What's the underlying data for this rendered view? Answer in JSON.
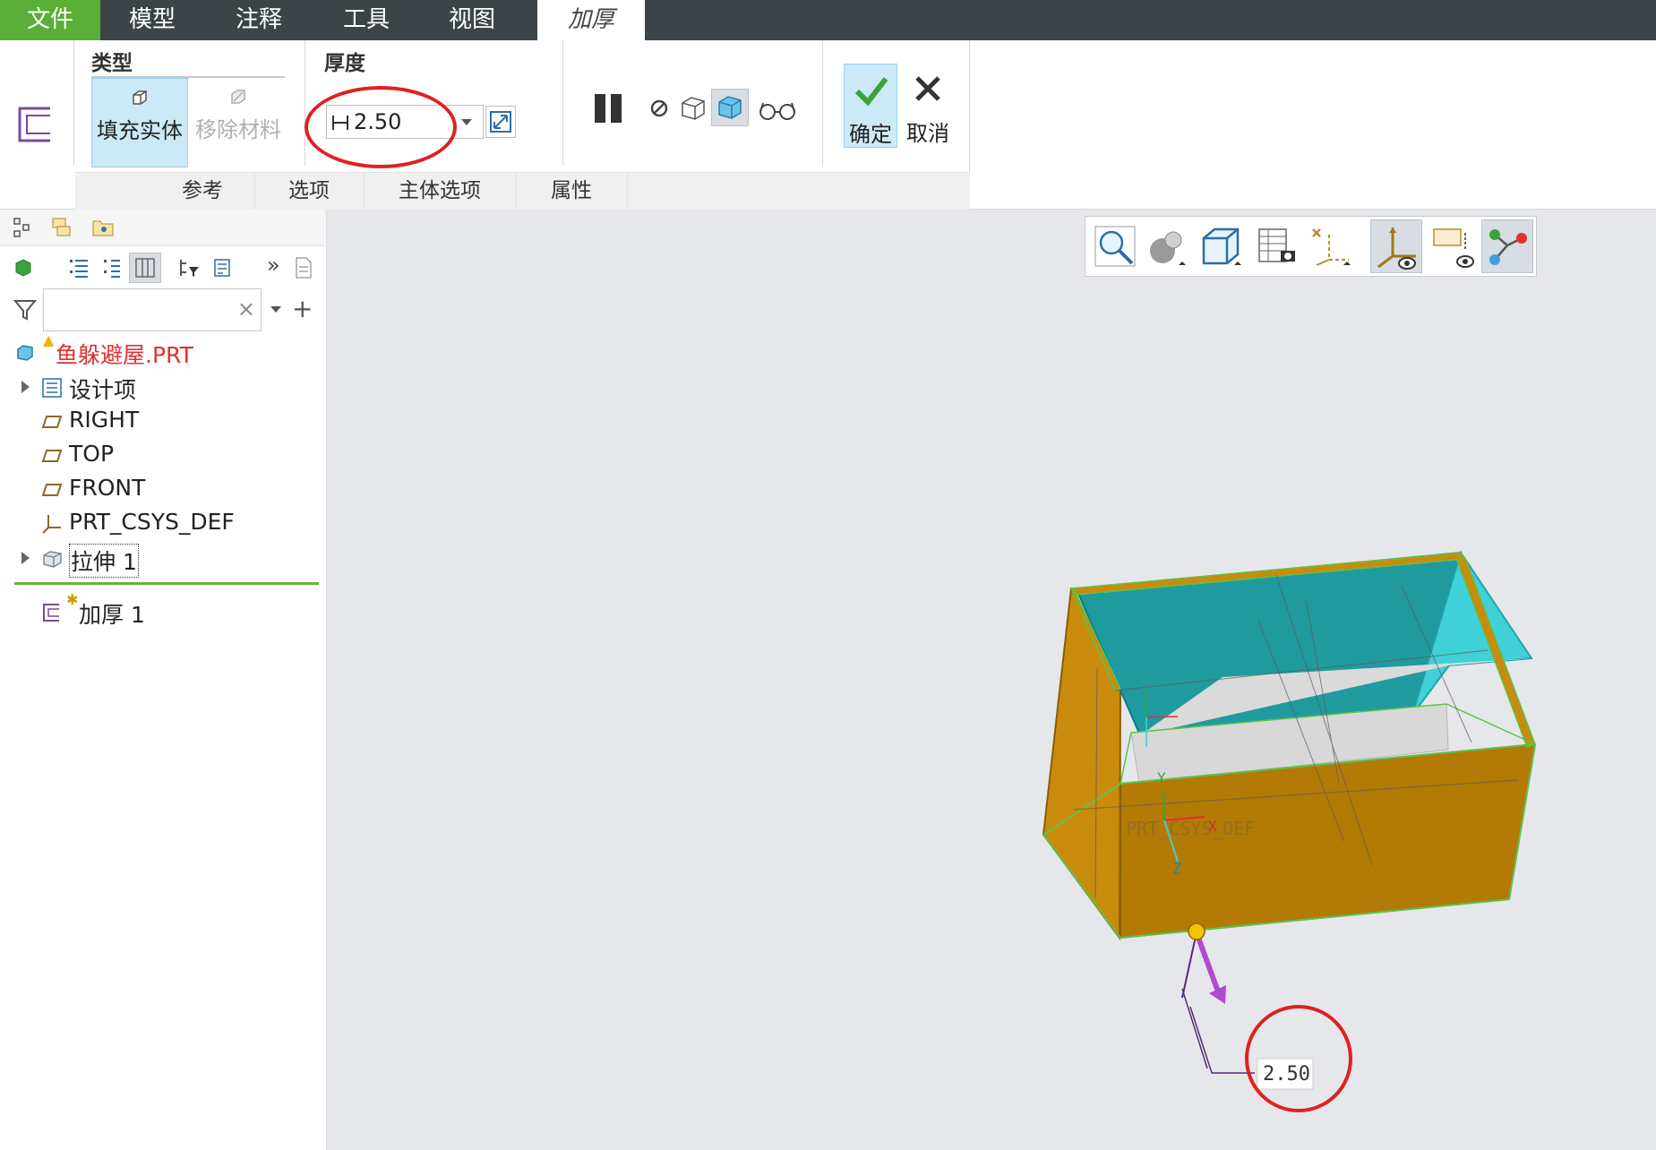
{
  "menu": {
    "tabs": [
      "文件",
      "模型",
      "注释",
      "工具",
      "视图"
    ],
    "active_tab": "加厚"
  },
  "ribbon": {
    "type_group": {
      "title": "类型",
      "fill_solid": "填充实体",
      "remove_material": "移除材料"
    },
    "thickness_group": {
      "title": "厚度",
      "value": "2.50"
    },
    "actions": {
      "ok": "确定",
      "cancel": "取消"
    },
    "subtabs": [
      "参考",
      "选项",
      "主体选项",
      "属性"
    ]
  },
  "model_tree": {
    "search_placeholder": "",
    "items": [
      {
        "label": "鱼躲避屋.PRT",
        "icon": "part-icon"
      },
      {
        "label": "设计项",
        "icon": "design-items-icon"
      },
      {
        "label": "RIGHT",
        "icon": "datum-plane-icon"
      },
      {
        "label": "TOP",
        "icon": "datum-plane-icon"
      },
      {
        "label": "FRONT",
        "icon": "datum-plane-icon"
      },
      {
        "label": "PRT_CSYS_DEF",
        "icon": "csys-icon"
      },
      {
        "label": "拉伸 1",
        "icon": "extrude-icon"
      },
      {
        "label": "加厚 1",
        "icon": "thicken-icon"
      }
    ]
  },
  "viewport": {
    "dimension_label": "2.50",
    "csys_label": "PRT_CSYS_DEF",
    "axis_labels": {
      "x": "X",
      "y": "Y",
      "z": "Z"
    }
  },
  "colors": {
    "menubar": "#3c4447",
    "file_tab": "#5ab036",
    "selected_button": "#cce9f7",
    "model_outer": "#c98b0c",
    "model_inner_wall": "#1f9b9f",
    "annotation_ring": "#e02020"
  }
}
